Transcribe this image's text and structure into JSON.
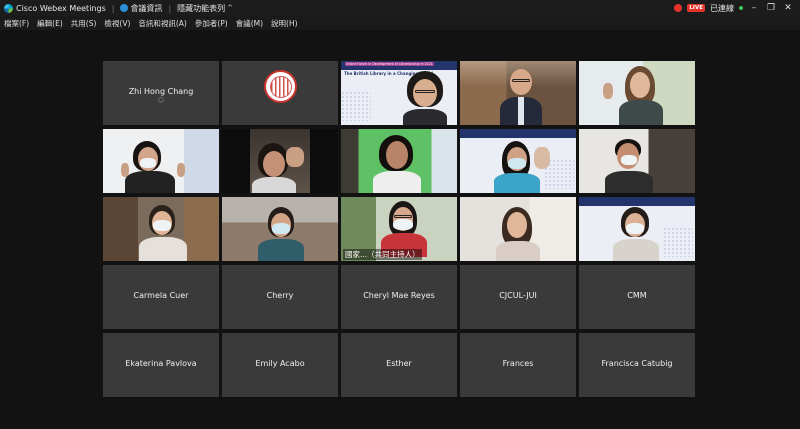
{
  "titlebar": {
    "app_title": "Cisco Webex Meetings",
    "meeting_info": "會議資訊",
    "hide_menu": "隱藏功能表列",
    "live": "LIVE",
    "connected": "已連線"
  },
  "menu": [
    "檔案(F)",
    "編輯(E)",
    "共用(S)",
    "檢視(V)",
    "音訊和視訊(A)",
    "參加者(P)",
    "會議(M)",
    "說明(H)"
  ],
  "participants": {
    "row1": {
      "zhi": "Zhi Hong Chang"
    },
    "slide_tile": {
      "header": "Online Forum in Development of Librarianship in 2021",
      "title": "The British Library in a Changing World"
    },
    "cohost_caption": "國家...（共同主持人）",
    "row4": [
      "Carmela Cuer",
      "Cherry",
      "Cheryl Mae Reyes",
      "CJCUL-JUI",
      "CMM"
    ],
    "row5": [
      "Ekaterina Pavlova",
      "Emily Acabo",
      "Esther",
      "Frances",
      "Francisca Catubig"
    ]
  }
}
